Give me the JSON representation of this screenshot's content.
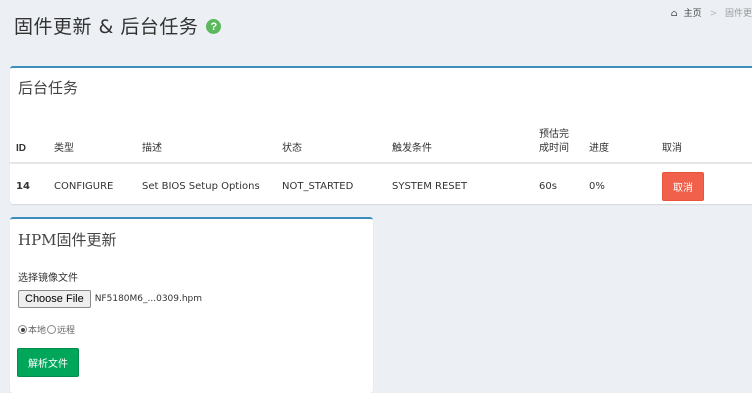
{
  "header": {
    "title": "固件更新 & 后台任务",
    "help_icon": "question-circle-icon",
    "help_glyph": "?"
  },
  "breadcrumb": {
    "home_icon": "home-icon",
    "home_glyph": "⌂",
    "home": "主页",
    "separator": ">",
    "current": "固件更"
  },
  "tasks_box": {
    "title": "后台任务",
    "columns": [
      "ID",
      "类型",
      "描述",
      "状态",
      "触发条件",
      "预估完成时间",
      "进度",
      "取消"
    ],
    "rows": [
      {
        "id": "14",
        "type": "CONFIGURE",
        "description": "Set BIOS Setup Options",
        "status": "NOT_STARTED",
        "trigger": "SYSTEM RESET",
        "eta": "60s",
        "progress": "0%",
        "cancel_label": "取消"
      }
    ]
  },
  "hpm_box": {
    "title": "HPM固件更新",
    "file_label": "选择镜像文件",
    "choose_file_label": "Choose File",
    "file_name": "NF5180M6_...0309.hpm",
    "source_options": [
      "本地",
      "远程"
    ],
    "source_selected": "本地",
    "parse_label": "解析文件"
  },
  "colors": {
    "accent": "#3c8dbc",
    "danger": "#f0604a",
    "success": "#00a65a",
    "background": "#ecf0f5"
  }
}
